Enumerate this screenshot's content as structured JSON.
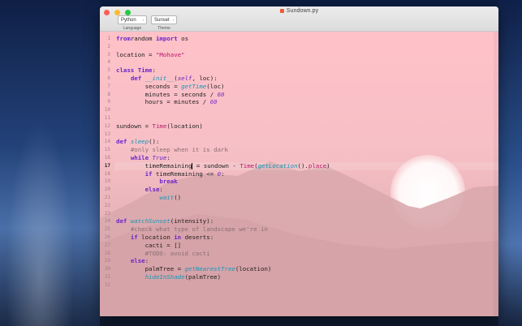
{
  "window": {
    "title": "Sundown.py"
  },
  "toolbar": {
    "language_value": "Python",
    "language_caption": "Language",
    "theme_value": "Sunset",
    "theme_caption": "Theme"
  },
  "editor": {
    "current_line": 17,
    "lines": [
      {
        "n": "1",
        "t": [
          [
            "kw",
            "from"
          ],
          [
            "",
            "random"
          ],
          [
            "kw",
            " import"
          ],
          [
            "",
            " os"
          ]
        ]
      },
      {
        "n": "2",
        "t": []
      },
      {
        "n": "3",
        "t": [
          [
            "",
            "location = "
          ],
          [
            "str",
            "\"Mohave\""
          ]
        ]
      },
      {
        "n": "4",
        "t": []
      },
      {
        "n": "5",
        "t": [
          [
            "kw",
            "class"
          ],
          [
            "",
            " "
          ],
          [
            "kw",
            "Time"
          ],
          [
            "",
            ":"
          ]
        ]
      },
      {
        "n": "6",
        "t": [
          [
            "",
            "    "
          ],
          [
            "kw",
            "def"
          ],
          [
            "",
            " "
          ],
          [
            "fn",
            "__init__"
          ],
          [
            "",
            "("
          ],
          [
            "self",
            "self"
          ],
          [
            "",
            ", loc):"
          ]
        ]
      },
      {
        "n": "7",
        "t": [
          [
            "",
            "        seconds = "
          ],
          [
            "fn",
            "getTime"
          ],
          [
            "",
            "(loc)"
          ]
        ]
      },
      {
        "n": "8",
        "t": [
          [
            "",
            "        minutes = seconds / "
          ],
          [
            "num",
            "60"
          ]
        ]
      },
      {
        "n": "9",
        "t": [
          [
            "",
            "        hours = minutes / "
          ],
          [
            "num",
            "60"
          ]
        ]
      },
      {
        "n": "10",
        "t": []
      },
      {
        "n": "11",
        "t": []
      },
      {
        "n": "12",
        "t": [
          [
            "",
            "sundown = "
          ],
          [
            "cls",
            "Time"
          ],
          [
            "",
            "(location)"
          ]
        ]
      },
      {
        "n": "13",
        "t": []
      },
      {
        "n": "14",
        "t": [
          [
            "kw",
            "def"
          ],
          [
            "",
            " "
          ],
          [
            "fn",
            "sleep"
          ],
          [
            "",
            "():"
          ]
        ]
      },
      {
        "n": "15",
        "t": [
          [
            "",
            "    "
          ],
          [
            "cmt",
            "#only sleep when it is dark"
          ]
        ]
      },
      {
        "n": "16",
        "t": [
          [
            "",
            "    "
          ],
          [
            "kw",
            "while"
          ],
          [
            "",
            " "
          ],
          [
            "self",
            "True"
          ],
          [
            "",
            ":"
          ]
        ]
      },
      {
        "n": "17",
        "t": [
          [
            "",
            "        timeRemaining"
          ],
          [
            "cursor",
            ""
          ],
          [
            "",
            " = sundown - "
          ],
          [
            "cls",
            "Time"
          ],
          [
            "",
            "("
          ],
          [
            "fn",
            "getLocation"
          ],
          [
            "",
            "()."
          ],
          [
            "cls",
            "place"
          ],
          [
            "",
            ")"
          ]
        ]
      },
      {
        "n": "18",
        "t": [
          [
            "",
            "        "
          ],
          [
            "kw",
            "if"
          ],
          [
            "",
            " timeRemaining <= "
          ],
          [
            "num",
            "0"
          ],
          [
            "",
            ":"
          ]
        ]
      },
      {
        "n": "19",
        "t": [
          [
            "",
            "            "
          ],
          [
            "kw",
            "break"
          ]
        ]
      },
      {
        "n": "20",
        "t": [
          [
            "",
            "        "
          ],
          [
            "kw",
            "else"
          ],
          [
            "",
            ":"
          ]
        ]
      },
      {
        "n": "21",
        "t": [
          [
            "",
            "            "
          ],
          [
            "fn",
            "wait"
          ],
          [
            "",
            "()"
          ]
        ]
      },
      {
        "n": "22",
        "t": []
      },
      {
        "n": "23",
        "t": []
      },
      {
        "n": "24",
        "t": [
          [
            "kw",
            "def"
          ],
          [
            "",
            " "
          ],
          [
            "fn",
            "watchSunset"
          ],
          [
            "",
            "(intensity):"
          ]
        ]
      },
      {
        "n": "25",
        "t": [
          [
            "",
            "    "
          ],
          [
            "cmt",
            "#check what type of landscape we're in"
          ]
        ]
      },
      {
        "n": "26",
        "t": [
          [
            "",
            "    "
          ],
          [
            "kw",
            "if"
          ],
          [
            "",
            " location "
          ],
          [
            "kw",
            "in"
          ],
          [
            "",
            " deserts:"
          ]
        ]
      },
      {
        "n": "27",
        "t": [
          [
            "",
            "        cacti = []"
          ]
        ]
      },
      {
        "n": "28",
        "t": [
          [
            "",
            "        "
          ],
          [
            "cmt",
            "#TODO: avoid cacti"
          ]
        ]
      },
      {
        "n": "29",
        "t": [
          [
            "",
            "    "
          ],
          [
            "kw",
            "else"
          ],
          [
            "",
            ":"
          ]
        ]
      },
      {
        "n": "30",
        "t": [
          [
            "",
            "        palmTree = "
          ],
          [
            "fn",
            "getNearestTree"
          ],
          [
            "",
            "(location)"
          ]
        ]
      },
      {
        "n": "31",
        "t": [
          [
            "",
            "        "
          ],
          [
            "fn",
            "hideInShade"
          ],
          [
            "",
            "(palmTree)"
          ]
        ]
      },
      {
        "n": "32",
        "t": []
      }
    ]
  }
}
